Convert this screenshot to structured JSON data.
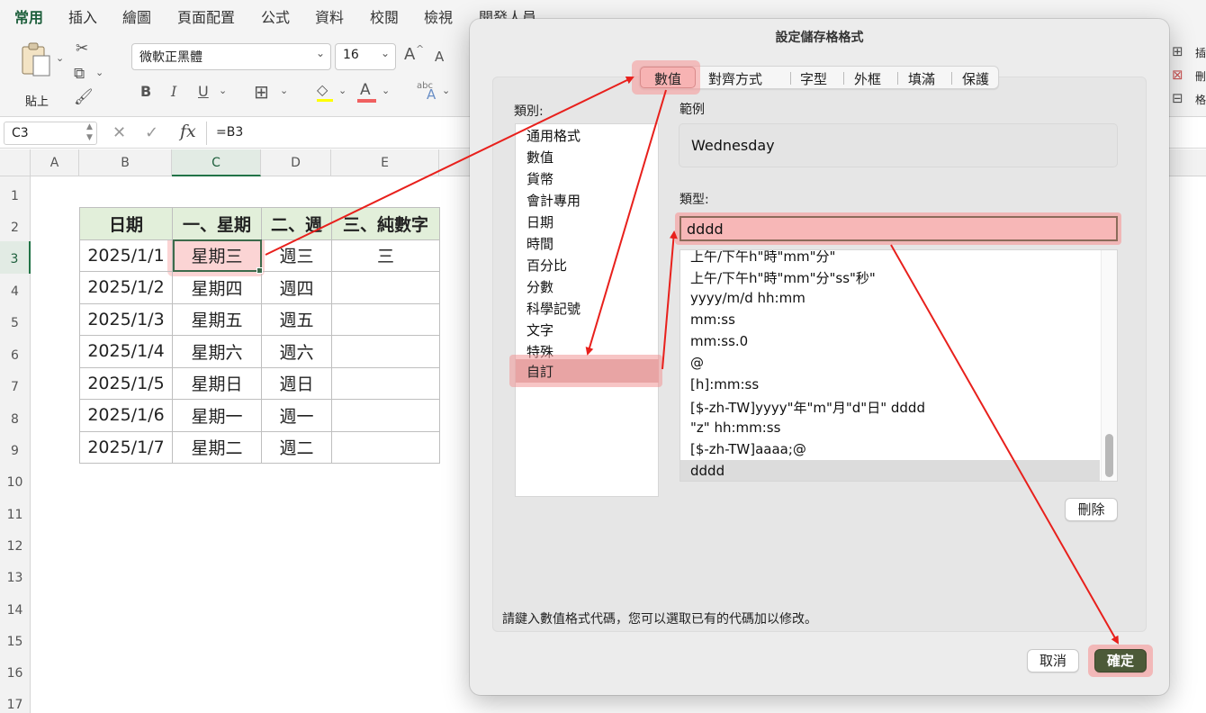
{
  "ribbon": {
    "tabs": [
      "常用",
      "插入",
      "繪圖",
      "頁面配置",
      "公式",
      "資料",
      "校閱",
      "檢視",
      "開發人員"
    ],
    "active_tab": "常用",
    "paste_label": "貼上",
    "font_name": "微軟正黑體",
    "font_size": "16",
    "grow_font": "A",
    "shrink_font": "A",
    "bold": "B",
    "italic": "I",
    "underline": "U",
    "font_color_letter": "A",
    "abc_label": "abc",
    "right_group": [
      "插",
      "刪",
      "格"
    ]
  },
  "formula_bar": {
    "name_box": "C3",
    "fx": "fx",
    "formula": "=B3"
  },
  "sheet": {
    "columns": [
      "A",
      "B",
      "C",
      "D",
      "E"
    ],
    "rows": [
      "1",
      "2",
      "3",
      "4",
      "5",
      "6",
      "7",
      "8",
      "9",
      "10",
      "11",
      "12",
      "13",
      "14",
      "15",
      "16",
      "17"
    ],
    "headers": [
      "日期",
      "一、星期",
      "二、週",
      "三、純數字"
    ],
    "data": [
      [
        "2025/1/1",
        "星期三",
        "週三",
        "三"
      ],
      [
        "2025/1/2",
        "星期四",
        "週四",
        ""
      ],
      [
        "2025/1/3",
        "星期五",
        "週五",
        ""
      ],
      [
        "2025/1/4",
        "星期六",
        "週六",
        ""
      ],
      [
        "2025/1/5",
        "星期日",
        "週日",
        ""
      ],
      [
        "2025/1/6",
        "星期一",
        "週一",
        ""
      ],
      [
        "2025/1/7",
        "星期二",
        "週二",
        ""
      ]
    ]
  },
  "dialog": {
    "title": "設定儲存格格式",
    "tabs": [
      "數值",
      "對齊方式",
      "字型",
      "外框",
      "填滿",
      "保護"
    ],
    "active_tab": "數值",
    "category_label": "類別:",
    "categories": [
      "通用格式",
      "數值",
      "貨幣",
      "會計專用",
      "日期",
      "時間",
      "百分比",
      "分數",
      "科學記號",
      "文字",
      "特殊",
      "自訂"
    ],
    "selected_category": "自訂",
    "sample_label": "範例",
    "sample_value": "Wednesday",
    "type_label": "類型:",
    "type_value": "dddd",
    "formats": [
      "上午/下午h\"時\"mm\"分\"",
      "上午/下午h\"時\"mm\"分\"ss\"秒\"",
      "yyyy/m/d hh:mm",
      "mm:ss",
      "mm:ss.0",
      "@",
      "[h]:mm:ss",
      "[$-zh-TW]yyyy\"年\"m\"月\"d\"日\" dddd",
      "\"z\" hh:mm:ss",
      "[$-zh-TW]aaaa;@",
      "dddd"
    ],
    "selected_format": "dddd",
    "delete_label": "刪除",
    "hint": "請鍵入數值格式代碼，您可以選取已有的代碼加以修改。",
    "cancel_label": "取消",
    "ok_label": "確定"
  },
  "colors": {
    "accent_green": "#217346",
    "highlight_pink": "#f7b3b3",
    "arrow_red": "#e8201c",
    "ok_button": "#4c5a38",
    "header_fill": "#e2efda"
  }
}
